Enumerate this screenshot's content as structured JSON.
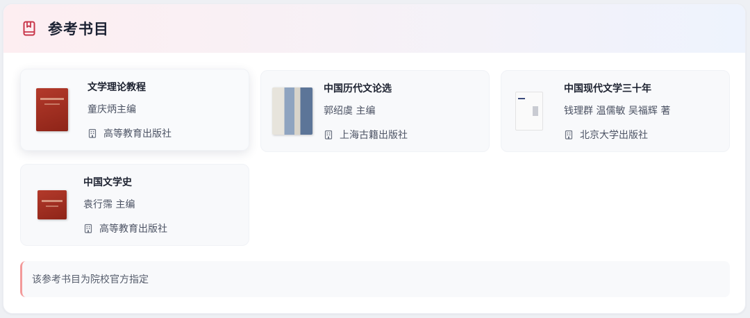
{
  "section": {
    "title": "参考书目",
    "icon": "book-icon",
    "accent": "#c8364a"
  },
  "books": [
    {
      "title": "文学理论教程",
      "author": "童庆炳主编",
      "publisher": "高等教育出版社",
      "cover": "red-cover"
    },
    {
      "title": "中国历代文论选",
      "author": "郭绍虞 主编",
      "publisher": "上海古籍出版社",
      "cover": "gray-cover"
    },
    {
      "title": "中国现代文学三十年",
      "author": "钱理群 温儒敏 吴福辉 著",
      "publisher": "北京大学出版社",
      "cover": "white-cover"
    },
    {
      "title": "中国文学史",
      "author": "袁行霈 主编",
      "publisher": "高等教育出版社",
      "cover": "red-cover"
    }
  ],
  "note": "该参考书目为院校官方指定"
}
